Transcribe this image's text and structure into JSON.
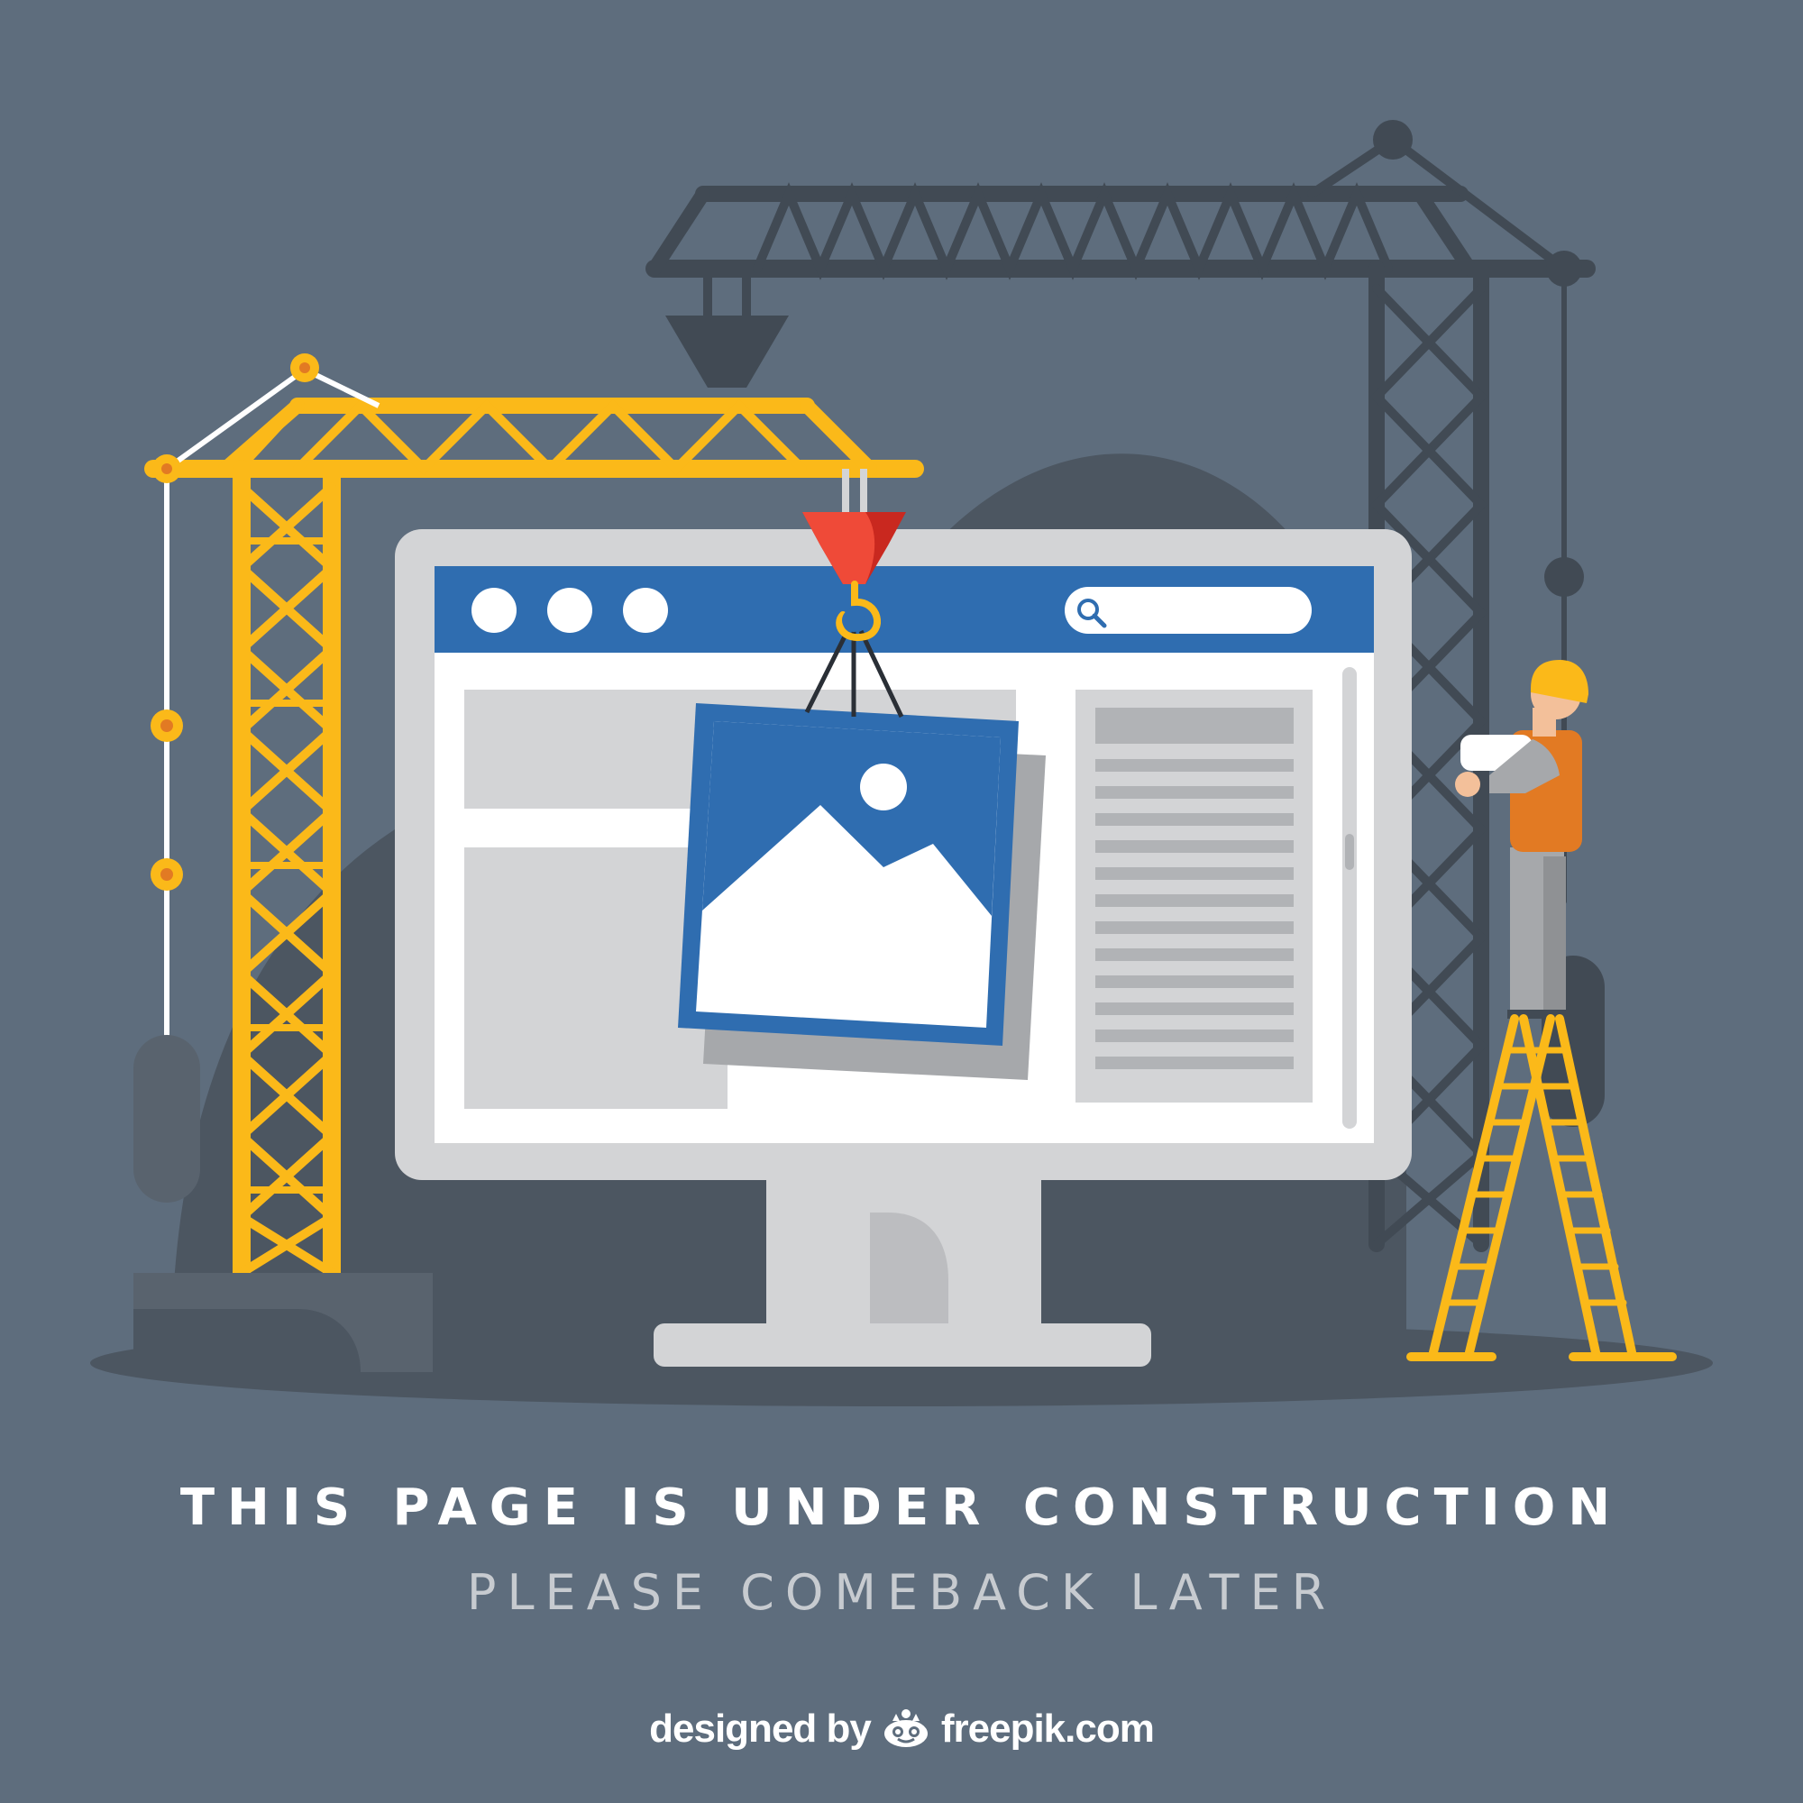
{
  "heading": "THIS PAGE IS UNDER CONSTRUCTION",
  "subheading": "PLEASE COMEBACK LATER",
  "credit": {
    "prefix": "designed by",
    "brand": "freepik.com",
    "logo_icon": "freepik-logo-icon"
  },
  "colors": {
    "background": "#5e6d7d",
    "shadow": "#4c5661",
    "dark_crane": "#414a54",
    "crane_yellow": "#fbb919",
    "browser_blue": "#2f6db0",
    "monitor_gray": "#d3d4d6",
    "hook_red": "#e0322a",
    "worker_orange": "#e27a23"
  },
  "illustration": {
    "browser_dots": [
      "dot",
      "dot",
      "dot"
    ],
    "search_icon": "search-icon",
    "image_icon": "image-icon"
  }
}
